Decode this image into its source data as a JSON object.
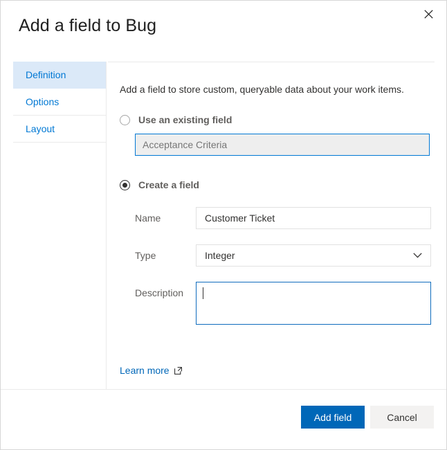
{
  "dialog": {
    "title": "Add a field to Bug",
    "close_icon": "close-icon"
  },
  "sidebar": {
    "items": [
      {
        "label": "Definition",
        "selected": true
      },
      {
        "label": "Options",
        "selected": false
      },
      {
        "label": "Layout",
        "selected": false
      }
    ]
  },
  "main": {
    "intro": "Add a field to store custom, queryable data about your work items.",
    "existing_field": {
      "radio_label": "Use an existing field",
      "selected": false,
      "value": "Acceptance Criteria"
    },
    "create_field": {
      "radio_label": "Create a field",
      "selected": true,
      "name": {
        "label": "Name",
        "value": "Customer Ticket"
      },
      "type": {
        "label": "Type",
        "value": "Integer",
        "chevron_icon": "chevron-down-icon"
      },
      "description": {
        "label": "Description",
        "value": "",
        "focused": true
      }
    },
    "learn_more": {
      "label": "Learn more",
      "icon": "external-link-icon"
    }
  },
  "footer": {
    "primary_label": "Add field",
    "secondary_label": "Cancel"
  },
  "colors": {
    "accent": "#0067b8",
    "link": "#0078d4",
    "selected_tab_bg": "#dbe9f8",
    "focus_border": "#0f6cbd",
    "disabled_bg": "#eeeeee"
  }
}
